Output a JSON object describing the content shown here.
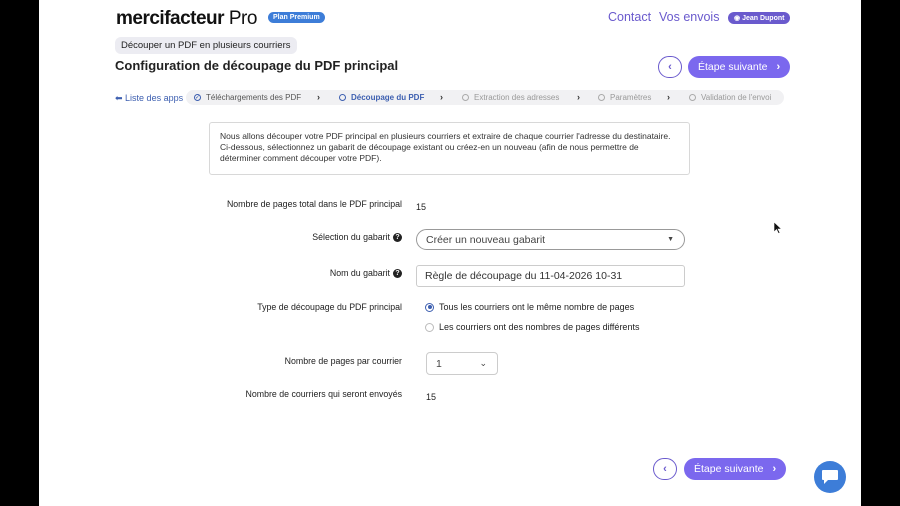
{
  "header": {
    "logo_main": "mercifacteur",
    "logo_pro": " Pro",
    "plan_badge": "Plan Premium",
    "nav": {
      "contact": "Contact",
      "envois": "Vos envois"
    },
    "user": "Jean Dupont"
  },
  "breadcrumb": "Découper un PDF en plusieurs courriers",
  "page_title": "Configuration de découpage du PDF principal",
  "buttons": {
    "back": "‹",
    "next": "Étape suivante"
  },
  "apps_link": "Liste des apps",
  "steps": [
    {
      "label": "Téléchargements des PDF",
      "state": "done"
    },
    {
      "label": "Découpage du PDF",
      "state": "active"
    },
    {
      "label": "Extraction des adresses",
      "state": "pending"
    },
    {
      "label": "Paramètres",
      "state": "pending"
    },
    {
      "label": "Validation de l'envoi",
      "state": "pending"
    }
  ],
  "info_text": "Nous allons découper votre PDF principal en plusieurs courriers et extraire de chaque courrier l'adresse du destinataire. Ci-dessous, sélectionnez un gabarit de découpage existant ou créez-en un nouveau (afin de nous permettre de déterminer comment découper votre PDF).",
  "form": {
    "total_pages_label": "Nombre de pages total dans le PDF principal",
    "total_pages_value": "15",
    "template_label": "Sélection du gabarit",
    "template_value": "Créer un nouveau gabarit",
    "name_label": "Nom du gabarit",
    "name_value": "Règle de découpage du 11-04-2026 10-31",
    "split_type_label": "Type de découpage du PDF principal",
    "split_option_same": "Tous les courriers ont le même nombre de pages",
    "split_option_diff": "Les courriers ont des nombres de pages différents",
    "pages_per_letter_label": "Nombre de pages par courrier",
    "pages_per_letter_value": "1",
    "letters_sent_label": "Nombre de courriers qui seront envoyés",
    "letters_sent_value": "15"
  },
  "colors": {
    "accent": "#7b68ee",
    "link": "#3d5fb0",
    "badge": "#3d7dd8"
  }
}
